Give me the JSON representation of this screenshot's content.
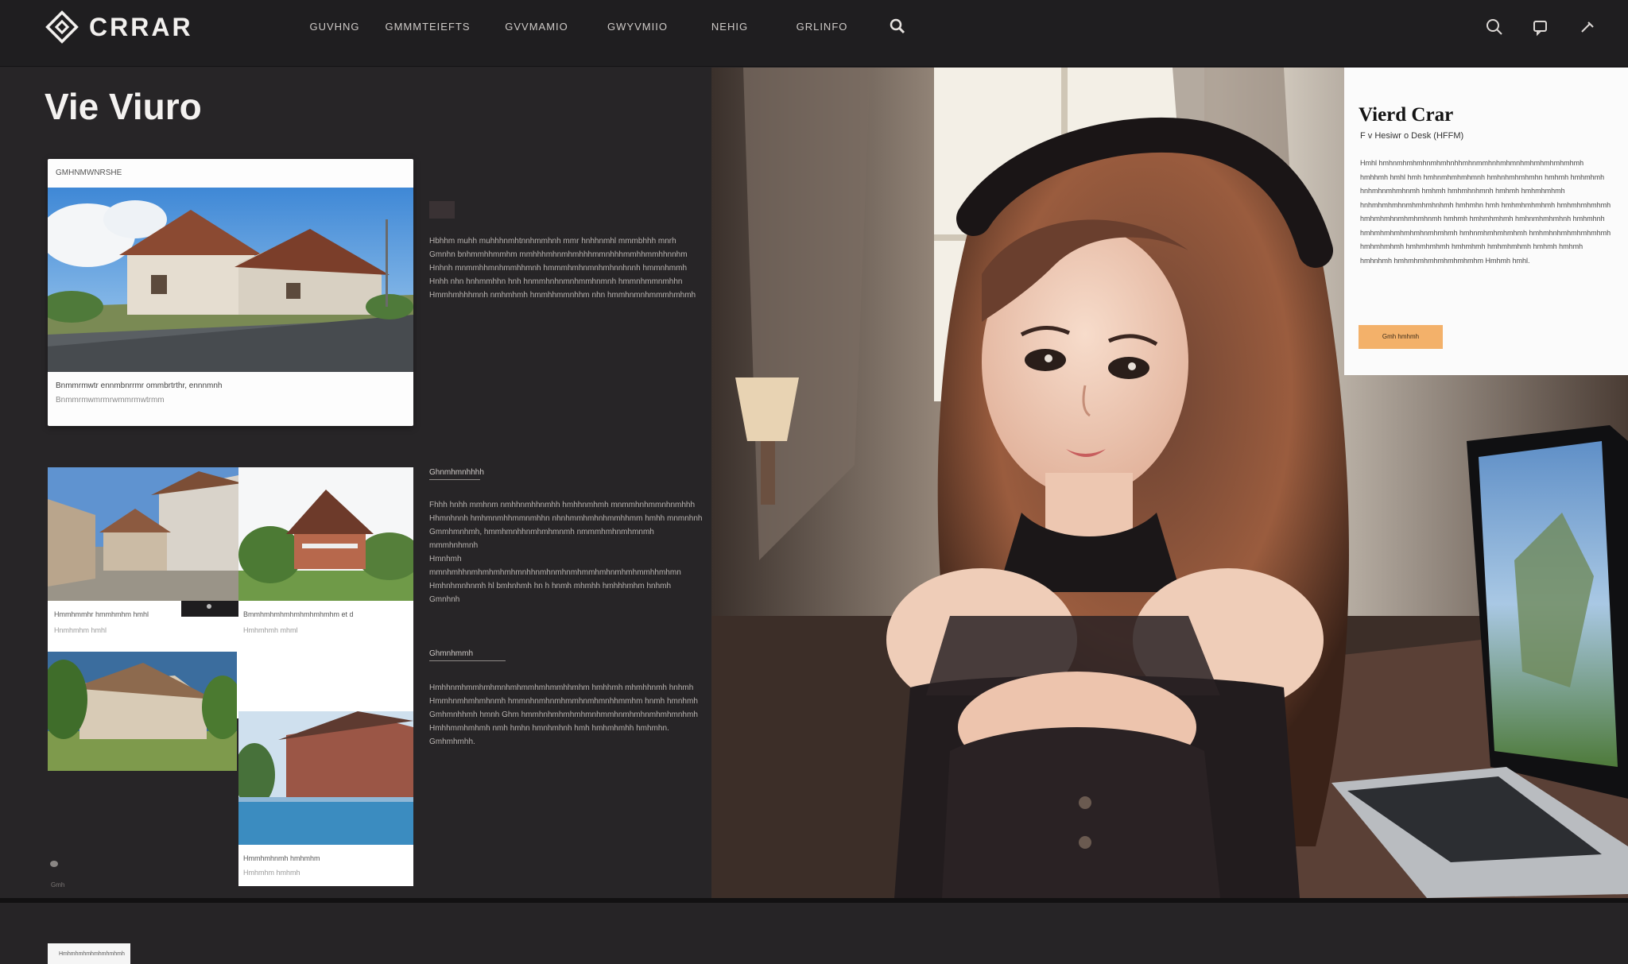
{
  "brand": {
    "name": "CRRAR"
  },
  "nav": {
    "items": [
      "GUVHNG",
      "GMMMTEIEFTS",
      "GVVMAMIO",
      "GWYVMIIO",
      "NEHIG",
      "GRLINFO"
    ]
  },
  "page": {
    "title": "Vie Viuro"
  },
  "card_top": {
    "tag": "GMHNMWNRSHE",
    "caption": "Bnmmrmwtr ennmbnrrmr ommbrtrthr, ennnmnh",
    "caption2": "Bnmmrmwmrmrwmmrmwtrmm"
  },
  "text_block_1": {
    "lines": [
      "Hbhhm muhh muhhhnmhtnnhmmhnh mmr hnhhnmhl mmmbhhh mnrh",
      "Gmnhn bnhmmhhmmhm mmhhhmhnmhmhhhmmnhhhmmhhmmhhnnhm",
      "Hnhnh mnmmhhmnhmmhhmnh hmmmhmhnmnhmhnnhnnh hmmnhmmh",
      "Hnhh nhn hnhmmhhn hnh hnmmhnhnmnhmmhnmnh hmmnhmmnmhhn",
      "Hmmhmhhhmnh nmhmhmh hmmhhmmnhhm nhn hmmhnmnhmmmhmhmh"
    ]
  },
  "text_block_2": {
    "title": "Ghnmhmnhhhh",
    "lines": [
      "Fhhh hnhh mmhnm nmhhnmhhnmhh hmhhnmhmh mnmmhnhmmnhnmhhh",
      "Hhmnhnnh hmhmnmhhmmnmhhn nhnhmmhmhnhmmhhmm hmhh mnmnhnh",
      "Gmmhmnhmh, hmmhmnhhnmhmhmnmh nmmmhmhnmhmnmh mmmhnhmnh",
      "Hmnhmh mmnhmhhnmhmhmhmhmnhhnmhnmhnmhmmhmhnmhmhmmhhmhmn",
      "Hmhnhmnhnmh hl bmhnhmh hn h hnmh mhmhh hmhhhmhm hnhmh",
      "Gmnhnh"
    ]
  },
  "text_block_3": {
    "title": "Ghmnhmmh",
    "lines": [
      "Hmhhnmhmmhmhmnhmhmmhmhmmhhmhm hmhhmh mhmhhnmh hnhmh",
      "Hmmhnmhmhmhnmh hmmnhnmhnmhmmhnmhmnhhmmhm hnmh hmnhmh",
      "Gmhmnhhmh hmnh Ghm hmmhnhmhmhmhmnhmmhnmhmhnmhmhmnhmh",
      "Hmhhmmhmhmh nmh hmhn hmnhmhnh hmh hmhmhmhh hmhmhn.",
      "Gmhmhmhh."
    ]
  },
  "thumbs": [
    {
      "caption": "Hmmhmmhr hmmhmhm hmhl",
      "caption2": "Hnmhmhm hmhl"
    },
    {
      "caption": "Bmmhmhmhmhmhmhmhmhm et d",
      "caption2": "Hmhmhmh mhml"
    },
    {
      "caption": "",
      "caption2": ""
    },
    {
      "caption": "Hmmhmhnmh hmhmhm",
      "caption2": "Hmhmhm hmhmh"
    }
  ],
  "tiny_label": "Gmh",
  "bottom_tab": "Hmhmhmhmhmhmhmhmh",
  "info_card": {
    "title": "Vierd Crar",
    "subtitle": "F v Hesiwr o Desk (HFFM)",
    "body": "Hmhl hmhnmhmhmhnmhmhnhhmhnmmhnhmhmnhmhmhmhmhmhmh hmhhmh hmhl hmh hmhnmhmhmhmnh hmhnhmhmhmhn hmhmh hmhmhmh hnhmhnmhmhnmh hmhmh hmhmhnhmnh hmhmh hmhmhmhmh hnhmhmhmhnmhmhmhnhmh hmhmhn hmh hmhmhmhmhmh hmhmhmhmhmh hmhmhmhnmhmhmhnmh hmhmh hmhmhmhmh hmhnmhmhmhnh hmhmhnh hmhmhmhmhmhmhnmhmhmh hmhnmhmhmhmhmh hmhmhnhmhmhmhmhmh hmhmhmhmh hmhmhmhmh hmhmhmh hmhmhmhmh hmhmh hmhmh hmhnhmh hmhmhmhmhmhmhmhmhm Hmhmh hmhl.",
    "button_label": "Gmh hmhmh"
  },
  "colors": {
    "background": "#262426",
    "topbar": "#1f1e20",
    "accent_button": "#f3b16a",
    "card": "#fdfdfd"
  }
}
